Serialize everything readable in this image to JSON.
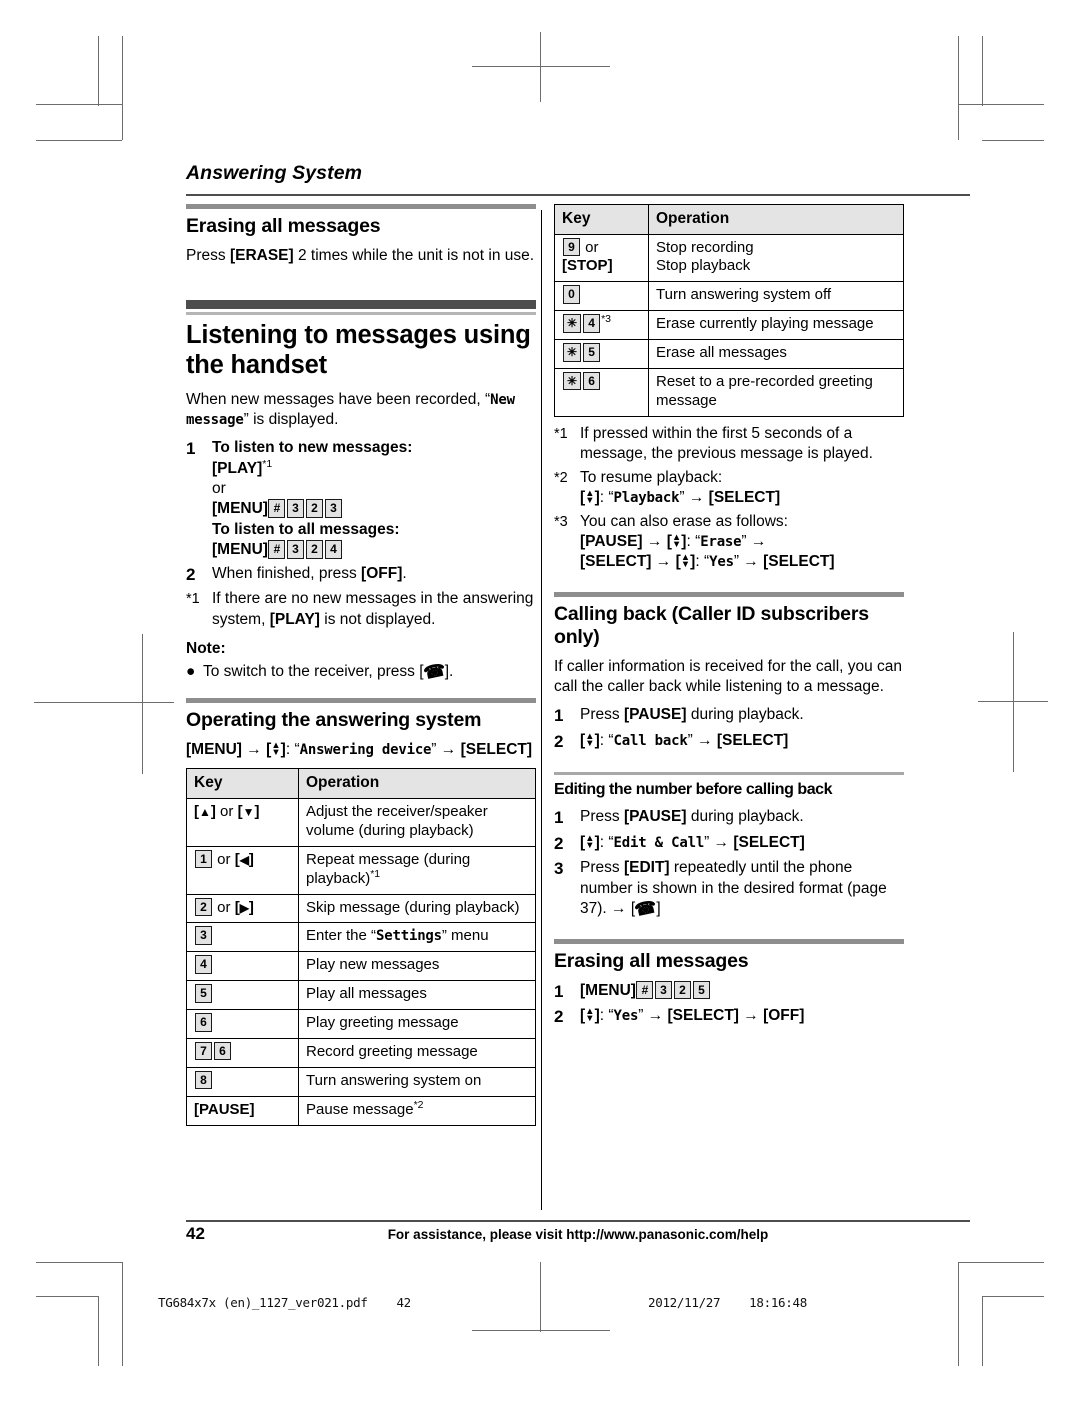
{
  "running_head": "Answering System",
  "footer": {
    "page_number": "42",
    "assistance": "For assistance, please visit http://www.panasonic.com/help",
    "stamp_file": "TG684x7x (en)_1127_ver021.pdf    42",
    "stamp_date": "2012/11/27    18:16:48"
  },
  "left_column": {
    "erasing": {
      "heading": "Erasing all messages",
      "body_before": "Press ",
      "key": "[ERASE]",
      "body_after": " 2 times while the unit is not in use."
    },
    "listening": {
      "heading": "Listening to messages using the handset",
      "intro_before": "When new messages have been recorded, “",
      "intro_display": "New message",
      "intro_after": "” is displayed.",
      "steps": [
        {
          "num": "1",
          "line1": "To listen to new messages:",
          "line2_key": "[PLAY]",
          "line2_fn": "*1",
          "line3": "or",
          "line4_key": "[MENU]",
          "line4_digits": [
            "#",
            "3",
            "2",
            "3"
          ],
          "line5": "To listen to all messages:",
          "line6_key": "[MENU]",
          "line6_digits": [
            "#",
            "3",
            "2",
            "4"
          ]
        },
        {
          "num": "2",
          "text_before": "When finished, press ",
          "key": "[OFF]",
          "text_after": "."
        }
      ],
      "footnote": {
        "mark": "*1",
        "before": "If there are no new messages in the answering system, ",
        "key": "[PLAY]",
        "after": " is not displayed."
      },
      "note_label": "Note:",
      "note_bullet": {
        "before": "To switch to the receiver, press [",
        "icon": "handset-icon",
        "after": "]."
      }
    },
    "operating": {
      "heading": "Operating the answering system",
      "path": {
        "menu": "[MENU]",
        "nav": "[↕]",
        "display": "Answering device",
        "select": "[SELECT]"
      },
      "table": {
        "headers": [
          "Key",
          "Operation"
        ],
        "rows": [
          {
            "key_type": "nav_pair",
            "key_glyphs": [
              "▲",
              "▼"
            ],
            "key_join": " or ",
            "operation": "Adjust the receiver/speaker volume (during playback)"
          },
          {
            "key_type": "box_nav",
            "key_box": "1",
            "key_join": " or ",
            "key_glyphs": [
              "◄"
            ],
            "operation": "Repeat message (during playback)",
            "operation_fn": "*1"
          },
          {
            "key_type": "box_nav",
            "key_box": "2",
            "key_join": " or ",
            "key_glyphs": [
              "►"
            ],
            "operation": "Skip message (during playback)"
          },
          {
            "key_type": "box",
            "key_boxes": [
              "3"
            ],
            "operation_before": "Enter the “",
            "operation_display": "Settings",
            "operation_after": "” menu"
          },
          {
            "key_type": "box",
            "key_boxes": [
              "4"
            ],
            "operation": "Play new messages"
          },
          {
            "key_type": "box",
            "key_boxes": [
              "5"
            ],
            "operation": "Play all messages"
          },
          {
            "key_type": "box",
            "key_boxes": [
              "6"
            ],
            "operation": "Play greeting message"
          },
          {
            "key_type": "box",
            "key_boxes": [
              "7",
              "6"
            ],
            "operation": "Record greeting message"
          },
          {
            "key_type": "box",
            "key_boxes": [
              "8"
            ],
            "operation": "Turn answering system on"
          },
          {
            "key_type": "bold",
            "key_text": "[PAUSE]",
            "operation": "Pause message",
            "operation_fn": "*2"
          }
        ]
      }
    }
  },
  "right_column": {
    "table": {
      "headers": [
        "Key",
        "Operation"
      ],
      "rows": [
        {
          "key_type": "box_bold",
          "key_boxes": [
            "9"
          ],
          "key_join": " or ",
          "key_bold": "[STOP]",
          "operation_line1": "Stop recording",
          "operation_line2": "Stop playback"
        },
        {
          "key_type": "box",
          "key_boxes": [
            "0"
          ],
          "operation": "Turn answering system off"
        },
        {
          "key_type": "box",
          "key_boxes": [
            "✳",
            "4"
          ],
          "key_fn": "*3",
          "operation": "Erase currently playing message"
        },
        {
          "key_type": "box",
          "key_boxes": [
            "✳",
            "5"
          ],
          "operation": "Erase all messages"
        },
        {
          "key_type": "box",
          "key_boxes": [
            "✳",
            "6"
          ],
          "operation": "Reset to a pre-recorded greeting message"
        }
      ]
    },
    "footnotes": [
      {
        "mark": "*1",
        "text": "If pressed within the first 5 seconds of a message, the previous message is played."
      },
      {
        "mark": "*2",
        "text": "To resume playback:",
        "path_nav": "[↕]",
        "path_display": "Playback",
        "path_select": "[SELECT]"
      },
      {
        "mark": "*3",
        "text": "You can also erase as follows:",
        "path_pause": "[PAUSE]",
        "path_nav1": "[↕]",
        "path_display1": "Erase",
        "path_select1": "[SELECT]",
        "path_nav2": "[↕]",
        "path_display2": "Yes",
        "path_select2": "[SELECT]"
      }
    ],
    "calling_back": {
      "heading": "Calling back (Caller ID subscribers only)",
      "body": "If caller information is received for the call, you can call the caller back while listening to a message.",
      "steps": [
        {
          "num": "1",
          "before": "Press ",
          "key": "[PAUSE]",
          "after": " during playback."
        },
        {
          "num": "2",
          "nav": "[↕]",
          "display": "Call back",
          "select": "[SELECT]"
        }
      ]
    },
    "editing": {
      "heading": "Editing the number before calling back",
      "steps": [
        {
          "num": "1",
          "before": "Press ",
          "key": "[PAUSE]",
          "after": " during playback."
        },
        {
          "num": "2",
          "nav": "[↕]",
          "display": "Edit & Call",
          "select": "[SELECT]"
        },
        {
          "num": "3",
          "before": "Press ",
          "key": "[EDIT]",
          "after": " repeatedly until the phone number is shown in the desired format (page 37). → [",
          "icon": "handset-icon",
          "tail": "]"
        }
      ]
    },
    "erasing": {
      "heading": "Erasing all messages",
      "steps": [
        {
          "num": "1",
          "key": "[MENU]",
          "digits": [
            "#",
            "3",
            "2",
            "5"
          ]
        },
        {
          "num": "2",
          "nav": "[↕]",
          "display": "Yes",
          "select": "[SELECT]",
          "off": "[OFF]"
        }
      ]
    }
  },
  "colors": {
    "major_bar": "#4d4d4d",
    "sub_bar": "#8e8e8e",
    "minor_bar": "#a8a8a8",
    "table_header_bg": "#e4e4e4",
    "key_box_bg": "#e2e2e2"
  }
}
